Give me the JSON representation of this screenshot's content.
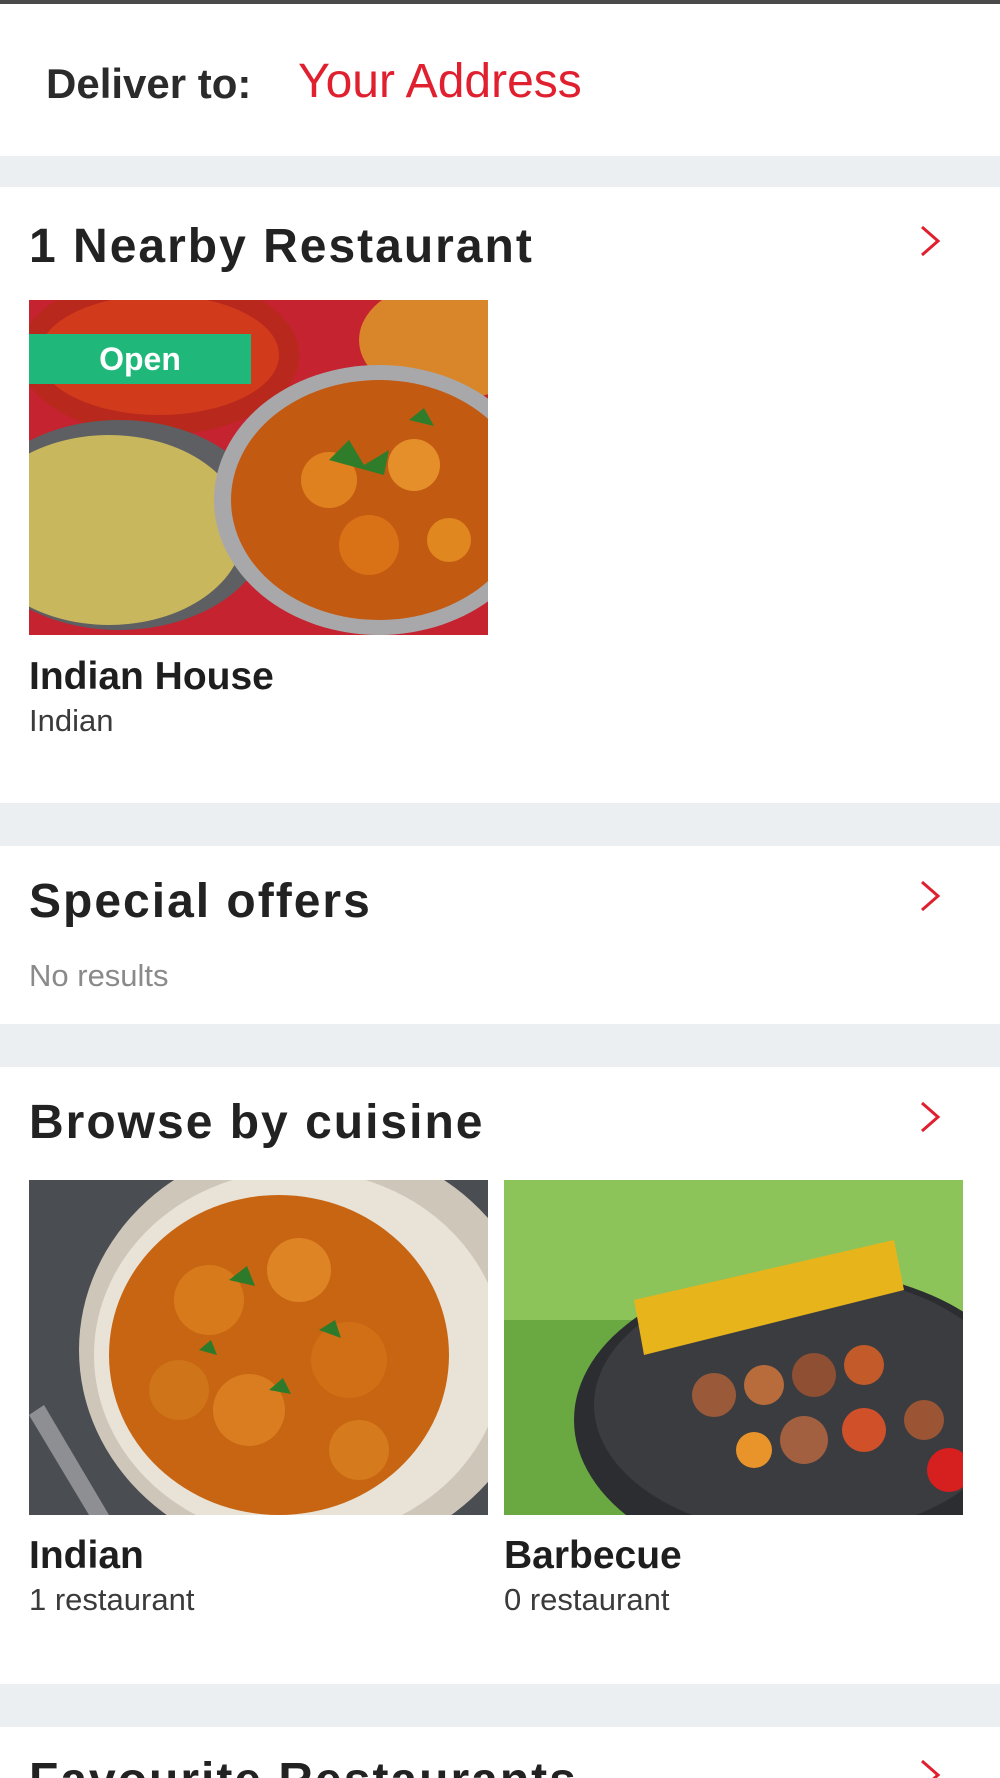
{
  "header": {
    "deliver_label": "Deliver to:",
    "address": "Your Address"
  },
  "nearby": {
    "title": "1 Nearby Restaurant",
    "restaurants": [
      {
        "name": "Indian House",
        "cuisine": "Indian",
        "status": "Open"
      }
    ]
  },
  "offers": {
    "title": "Special offers",
    "empty_text": "No results"
  },
  "cuisines": {
    "title": "Browse by cuisine",
    "items": [
      {
        "name": "Indian",
        "count": "1 restaurant"
      },
      {
        "name": "Barbecue",
        "count": "0 restaurant"
      }
    ]
  },
  "favourites": {
    "title": "Favourite Restaurants"
  },
  "icons": {
    "section_link": "chevron-right-icon"
  },
  "colors": {
    "accent": "#e0202e",
    "open_badge": "#1fb87a",
    "background": "#eceff1"
  }
}
